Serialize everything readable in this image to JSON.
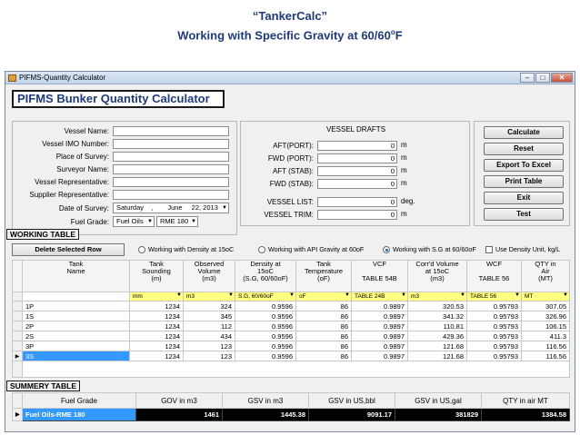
{
  "slide": {
    "title": "“TankerCalc”",
    "subtitle": "Working with Specific Gravity at 60/60",
    "subtitle_sup": "o",
    "subtitle_end": "F"
  },
  "window": {
    "title": "PIFMS-Quantity Calculator",
    "min_label": "–",
    "max_label": "□",
    "close_label": "✕"
  },
  "header": {
    "title": "PIFMS Bunker Quantity Calculator"
  },
  "vessel_info": {
    "fields": [
      {
        "label": "Vessel Name:",
        "value": ""
      },
      {
        "label": "Vessel IMO Number:",
        "value": ""
      },
      {
        "label": "Place of Survey:",
        "value": ""
      },
      {
        "label": "Surveyor Name:",
        "value": ""
      },
      {
        "label": "Vessel Representative:",
        "value": ""
      },
      {
        "label": "Supplier Representative:",
        "value": ""
      }
    ],
    "date_label": "Date of Survey:",
    "date_day": "Saturday",
    "date_sep": ",",
    "date_month": "June",
    "date_rest": "22, 2013",
    "fuel_label": "Fuel Grade:",
    "fuel_type": "Fuel Oils",
    "fuel_grade": "RME 180"
  },
  "drafts": {
    "title": "VESSEL DRAFTS",
    "rows": [
      {
        "label": "AFT(PORT):",
        "value": "0",
        "unit": "m"
      },
      {
        "label": "FWD (PORT):",
        "value": "0",
        "unit": "m"
      },
      {
        "label": "AFT (STAB):",
        "value": "0",
        "unit": "m"
      },
      {
        "label": "FWD (STAB):",
        "value": "0",
        "unit": "m"
      }
    ],
    "list_label": "VESSEL LIST:",
    "list_value": "0",
    "list_unit": "deg.",
    "trim_label": "VESSEL TRIM:",
    "trim_value": "0",
    "trim_unit": "m"
  },
  "actions": [
    "Calculate",
    "Reset",
    "Export To Excel",
    "Print Table",
    "Exit",
    "Test"
  ],
  "working": {
    "section_label": "WORKING TABLE",
    "delete_label": "Delete Selected Row",
    "radios": [
      {
        "label": "Working with Density at 15oC",
        "checked": false
      },
      {
        "label": "Working with API Gravity at 60oF",
        "checked": false
      },
      {
        "label": "Working with S.G at 60/60oF",
        "checked": true
      }
    ],
    "checkbox_label": "Use Density Unit, kg/L",
    "columns": [
      {
        "lines": [
          "Tank",
          "Name"
        ]
      },
      {
        "lines": [
          "Tank",
          "Sounding",
          "(m)"
        ]
      },
      {
        "lines": [
          "Observed",
          "Volume",
          "(m3)"
        ]
      },
      {
        "lines": [
          "Density at",
          "15oC",
          "(S.G, 60/60oF)"
        ]
      },
      {
        "lines": [
          "Tank",
          "Temperature",
          "(oF)"
        ]
      },
      {
        "lines": [
          "VCF",
          "",
          "TABLE 54B"
        ]
      },
      {
        "lines": [
          "Corr'd Volume",
          "at 15oC",
          "(m3)"
        ]
      },
      {
        "lines": [
          "WCF",
          "",
          "TABLE 56"
        ]
      },
      {
        "lines": [
          "QTY in",
          "Air",
          "(MT)"
        ]
      }
    ],
    "unit_selectors": [
      "",
      "mm",
      "m3",
      "S.G, 60/60oF",
      "oF",
      "TABLE 24B",
      "m3",
      "TABLE 56",
      "MT"
    ],
    "rows": [
      [
        "1P",
        "1234",
        "324",
        "0.9596",
        "86",
        "0.9897",
        "320.53",
        "0.95793",
        "307.05"
      ],
      [
        "1S",
        "1234",
        "345",
        "0.9596",
        "86",
        "0.9897",
        "341.32",
        "0.95793",
        "326.96"
      ],
      [
        "2P",
        "1234",
        "112",
        "0.9596",
        "86",
        "0.9897",
        "110.81",
        "0.95793",
        "106.15"
      ],
      [
        "2S",
        "1234",
        "434",
        "0.9596",
        "86",
        "0.9897",
        "429.36",
        "0.95793",
        "411.3"
      ],
      [
        "3P",
        "1234",
        "123",
        "0.9596",
        "86",
        "0.9897",
        "121.68",
        "0.95793",
        "116.56"
      ],
      [
        "3S",
        "1234",
        "123",
        "0.9596",
        "86",
        "0.9897",
        "121.68",
        "0.95793",
        "116.56"
      ]
    ],
    "current_row_marker": "▶"
  },
  "summary": {
    "section_label": "SUMMERY TABLE",
    "columns": [
      "Fuel Grade",
      "GOV in m3",
      "GSV in m3",
      "GSV in US,bbl",
      "GSV in US,gal",
      "QTY in air MT"
    ],
    "row": [
      "Fuel Oils-RME 180",
      "1461",
      "1445.38",
      "9091.17",
      "381829",
      "1384.58"
    ],
    "current_row_marker": "▶"
  }
}
